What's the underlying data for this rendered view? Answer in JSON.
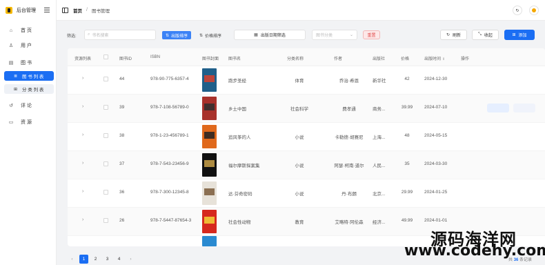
{
  "app": {
    "title": "后台管理"
  },
  "sidebar": {
    "items": [
      {
        "label": "首 页",
        "icon": "home-icon"
      },
      {
        "label": "用 户",
        "icon": "user-icon"
      },
      {
        "label": "图 书",
        "icon": "book-icon"
      },
      {
        "label": "评 论",
        "icon": "comment-icon"
      },
      {
        "label": "资 源",
        "icon": "resource-icon"
      }
    ],
    "subitems": [
      {
        "label": "图 书 列 表",
        "active": true,
        "icon": "list-icon"
      },
      {
        "label": "分 类 列 表",
        "active": false,
        "icon": "category-icon"
      }
    ]
  },
  "header": {
    "breadcrumb_home": "首页",
    "breadcrumb_sep": "/",
    "breadcrumb_current": "图书管理",
    "refresh_glyph": "↻"
  },
  "filters": {
    "label": "筛选:",
    "search_placeholder": "书名搜索",
    "sort_publish": "出版排序",
    "sort_price": "价格排序",
    "date_filter": "出版日期筛选",
    "category_placeholder": "图书分类",
    "reset": "重置",
    "refresh": "刷新",
    "collapse": "收起",
    "add": "添加"
  },
  "table": {
    "columns": [
      "资源列表",
      "图书ID",
      "ISBN",
      "图书封面",
      "图书名",
      "分类名称",
      "作者",
      "出版社",
      "价格",
      "出版时间",
      "操作"
    ],
    "rows": [
      {
        "id": "44",
        "isbn": "978-90-775-6357-4",
        "title": "跑步圣经",
        "category": "体育",
        "author": "乔治·希恩",
        "publisher": "新华社",
        "price": "42",
        "date": "2024-12-30"
      },
      {
        "id": "39",
        "isbn": "978-7-108-56789-0",
        "title": "乡土中国",
        "category": "社会科学",
        "author": "费孝通",
        "publisher": "商务...",
        "price": "39.99",
        "date": "2024-07-10"
      },
      {
        "id": "38",
        "isbn": "978-1-23-456789-1",
        "title": "追风筝的人",
        "category": "小说",
        "author": "卡勒德·胡赛尼",
        "publisher": "上海...",
        "price": "48",
        "date": "2024-05-15"
      },
      {
        "id": "37",
        "isbn": "978-7-543-23456-9",
        "title": "福尔摩斯探案集",
        "category": "小说",
        "author": "阿瑟·柯南·道尔",
        "publisher": "人民...",
        "price": "35",
        "date": "2024-03-30"
      },
      {
        "id": "36",
        "isbn": "978-7-300-12345-8",
        "title": "达·芬奇密码",
        "category": "小说",
        "author": "丹·布朗",
        "publisher": "北京...",
        "price": "29.99",
        "date": "2024-01-25"
      },
      {
        "id": "26",
        "isbn": "978-7-5447-87654-3",
        "title": "社会性动物",
        "category": "教育",
        "author": "艾略特·阿伦森",
        "publisher": "经济...",
        "price": "49.99",
        "date": "2024-01-01"
      }
    ]
  },
  "covers": [
    {
      "bg": "#1f5f8a",
      "accent": "#d9402b"
    },
    {
      "bg": "#a8312b",
      "accent": "#2f2f2f"
    },
    {
      "bg": "#e0691c",
      "accent": "#222"
    },
    {
      "bg": "#111111",
      "accent": "#c9a14a"
    },
    {
      "bg": "#e7e2d9",
      "accent": "#7a5a3a"
    },
    {
      "bg": "#d6281e",
      "accent": "#f3d23a"
    }
  ],
  "pagination": {
    "pages": [
      "1",
      "2",
      "3",
      "4"
    ],
    "prev": "‹",
    "next": "›",
    "total_prefix": "共",
    "total_count": "36",
    "total_suffix": "条记录"
  },
  "watermark": {
    "line1": "源码海洋网",
    "line2": "www.codehy.com"
  },
  "colors": {
    "primary": "#1b6ef3",
    "danger": "#e24c4c",
    "logo": "#f5b800"
  }
}
